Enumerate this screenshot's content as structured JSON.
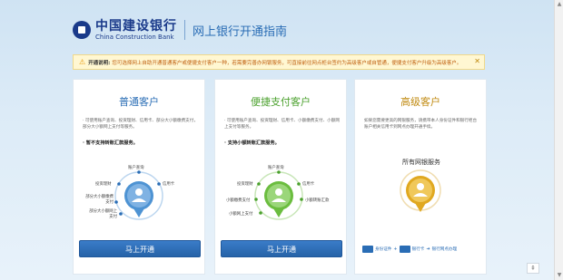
{
  "header": {
    "logo_cn": "中国建设银行",
    "logo_en": "China Construction Bank",
    "title": "网上银行开通指南"
  },
  "notice": {
    "label": "开通说明:",
    "text": "您可选择网上自助开通普通客户或便捷支付客户一种，若需要完善办网银服务，可直接前往网点柜台签约为高级客户或自管通，便捷支付客户升级为高级客户。"
  },
  "cards": [
    {
      "title": "普通客户",
      "title_color": "#2a6db5",
      "desc": "· 可使用账户查询、投资理财、信用卡、部分大小额缴费支付，部分大小额网上支付等服务。",
      "note": "· 暂不支持转账汇款服务。",
      "features": [
        "账户查询",
        "投资理财",
        "信用卡",
        "部分大小额缴费支付",
        "部分大小额网上支付"
      ],
      "button": "马上开通"
    },
    {
      "title": "便捷支付客户",
      "title_color": "#4aa02c",
      "desc": "· 可使用账户查询、投资理财、信用卡、小额缴费支付、小额网上支付等服务。",
      "note": "· 支持小额转账汇款服务。",
      "features": [
        "账户查询",
        "投资理财",
        "信用卡",
        "小额缴费支付",
        "小额转账汇款",
        "小额网上支付"
      ],
      "button": "马上开通"
    },
    {
      "title": "高级客户",
      "title_color": "#c08a10",
      "desc": "如果您需要更高的网银服务，请携带本人身份证件和银行柜台账户相关信用卡到网点办理开通手续。",
      "service_label": "所有网银服务",
      "steps": [
        "身份证件",
        "银行卡",
        "银行网点办理"
      ]
    }
  ],
  "colors": {
    "blue": "#2a6db5",
    "green": "#4aa02c",
    "gold": "#c08a10"
  }
}
